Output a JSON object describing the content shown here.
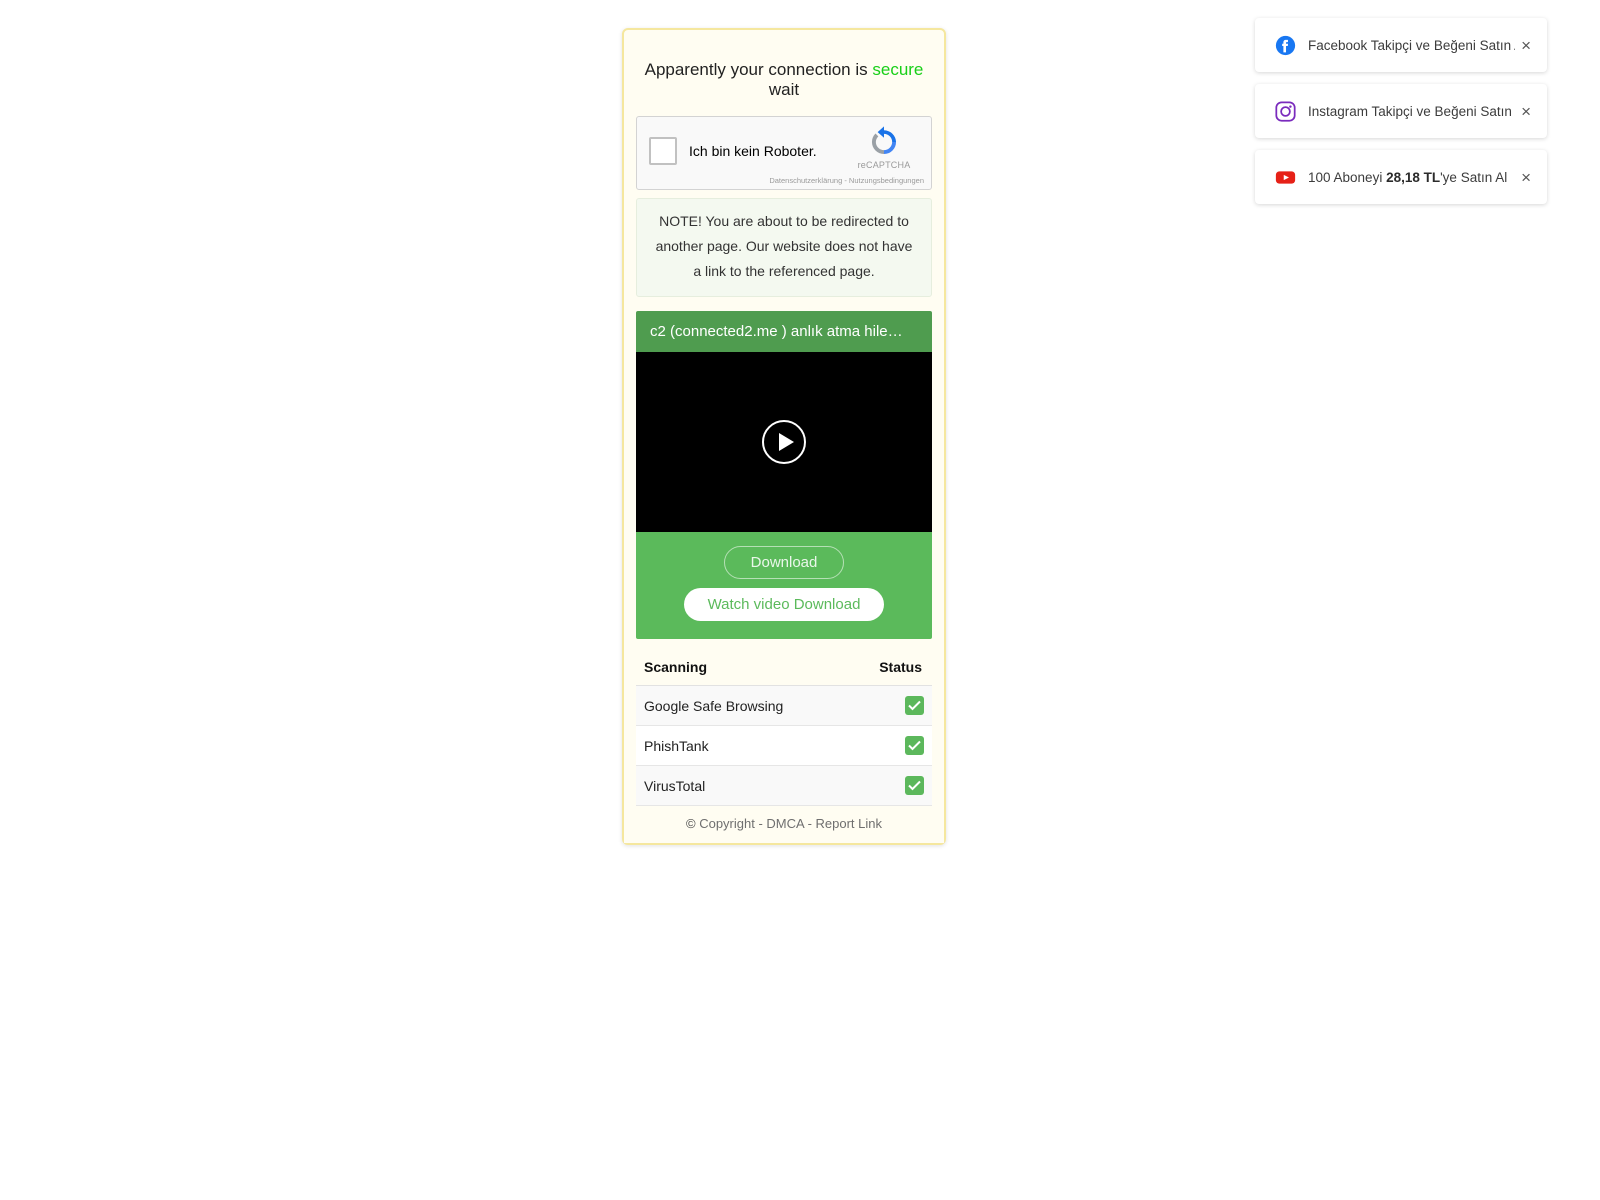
{
  "main_card": {
    "headline": {
      "prefix": "Apparently your connection is ",
      "secure_word": "secure",
      "suffix": " wait"
    },
    "recaptcha": {
      "checkbox_label": "Ich bin kein Roboter.",
      "brand_name": "reCAPTCHA",
      "terms": "Datenschutzerklärung - Nutzungsbedingungen",
      "logo_icon": "recaptcha-logo-icon",
      "checkbox_icon": "unchecked-checkbox-icon"
    },
    "note": "NOTE! You are about to be redirected to another page. Our website does not have a link to the referenced page.",
    "video": {
      "title": "c2 (connected2.me ) anlık atma hile…",
      "play_icon": "play-circle-icon",
      "download_button": "Download",
      "watch_button": "Watch video Download",
      "title_bar_color": "#4f9c4f",
      "actions_bar_color": "#5bba5b"
    },
    "scan_table": {
      "headers": [
        "Scanning",
        "Status"
      ],
      "rows": [
        {
          "name": "Google Safe Browsing",
          "status_icon": "green-check-icon"
        },
        {
          "name": "PhishTank",
          "status_icon": "green-check-icon"
        },
        {
          "name": "VirusTotal",
          "status_icon": "green-check-icon"
        }
      ]
    },
    "footer": {
      "copyright_symbol": "©",
      "text": " Copyright - DMCA - Report Link"
    },
    "border_color": "#f5e79e",
    "background_color": "#fffdf2",
    "secure_color": "#19cf19"
  },
  "notifications": [
    {
      "icon": "facebook-icon",
      "text": "Facebook Takipçi ve Beğeni Satın Al",
      "close_label": "×",
      "icon_color": "#1877f2"
    },
    {
      "icon": "instagram-icon",
      "text": "Instagram Takipçi ve Beğeni Satın Al",
      "close_label": "×",
      "icon_color": "#7a2bbd"
    },
    {
      "icon": "youtube-icon",
      "text_before": "100 Aboneyi ",
      "text_bold": "28,18 TL",
      "text_after": "'ye Satın Al",
      "close_label": "×",
      "icon_color": "#e62117"
    }
  ]
}
